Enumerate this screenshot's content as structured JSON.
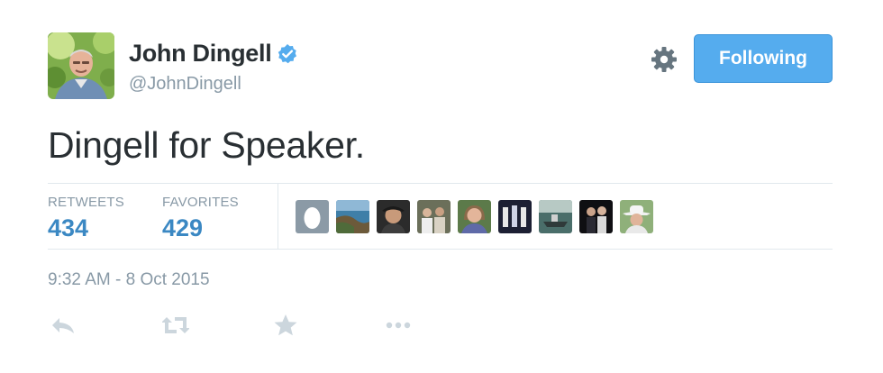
{
  "author": {
    "display_name": "John Dingell",
    "handle": "@JohnDingell",
    "verified": true
  },
  "follow_button": {
    "label": "Following"
  },
  "tweet": {
    "text": "Dingell for Speaker."
  },
  "stats": {
    "retweets_label": "RETWEETS",
    "retweets_count": "434",
    "favorites_label": "FAVORITES",
    "favorites_count": "429"
  },
  "favoriters": [
    "default-egg-avatar",
    "coastline-avatar",
    "man-in-hat-avatar",
    "group-photo-avatar",
    "smiling-woman-avatar",
    "people-standing-avatar",
    "boat-on-water-avatar",
    "night-couple-avatar",
    "cowboy-hat-avatar"
  ],
  "timestamp": "9:32 AM - 8 Oct 2015",
  "actions": [
    "reply-icon",
    "retweet-icon",
    "favorite-icon",
    "more-icon"
  ],
  "colors": {
    "accent": "#55acee",
    "stat_value": "#3b88c3",
    "muted_text": "#8899a6",
    "body_text": "#292f33",
    "verified_badge": "#55acee"
  }
}
